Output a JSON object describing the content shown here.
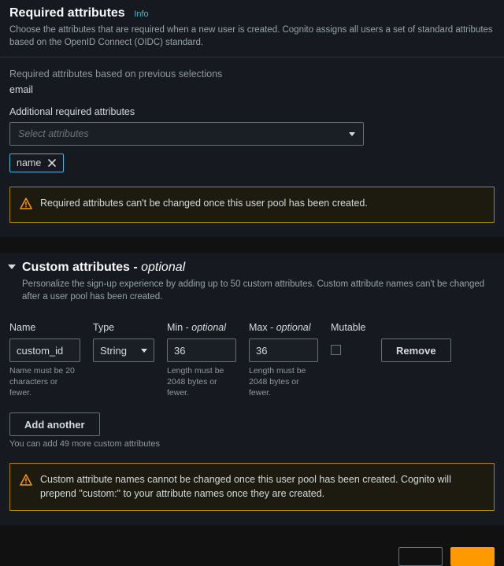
{
  "required": {
    "title": "Required attributes",
    "info": "Info",
    "description": "Choose the attributes that are required when a new user is created. Cognito assigns all users a set of standard attributes based on the OpenID Connect (OIDC) standard.",
    "prev_label": "Required attributes based on previous selections",
    "prev_value": "email",
    "additional_label": "Additional required attributes",
    "select_placeholder": "Select attributes",
    "token": "name",
    "warning": "Required attributes can't be changed once this user pool has been created."
  },
  "custom": {
    "title_prefix": "Custom attributes - ",
    "title_suffix": "optional",
    "description": "Personalize the sign-up experience by adding up to 50 custom attributes. Custom attribute names can't be changed after a user pool has been created.",
    "cols": {
      "name": "Name",
      "type": "Type",
      "min_prefix": "Min - ",
      "min_suffix": "optional",
      "max_prefix": "Max - ",
      "max_suffix": "optional",
      "mutable": "Mutable"
    },
    "row": {
      "name": "custom_id",
      "type": "String",
      "min": "36",
      "max": "36",
      "mutable": false
    },
    "hints": {
      "name": "Name must be 20 characters or fewer.",
      "min": "Length must be 2048 bytes or fewer.",
      "max": "Length must be 2048 bytes or fewer."
    },
    "remove": "Remove",
    "add": "Add another",
    "add_hint": "You can add 49 more custom attributes",
    "warning": "Custom attribute names cannot be changed once this user pool has been created. Cognito will prepend \"custom:\" to your attribute names once they are created."
  }
}
